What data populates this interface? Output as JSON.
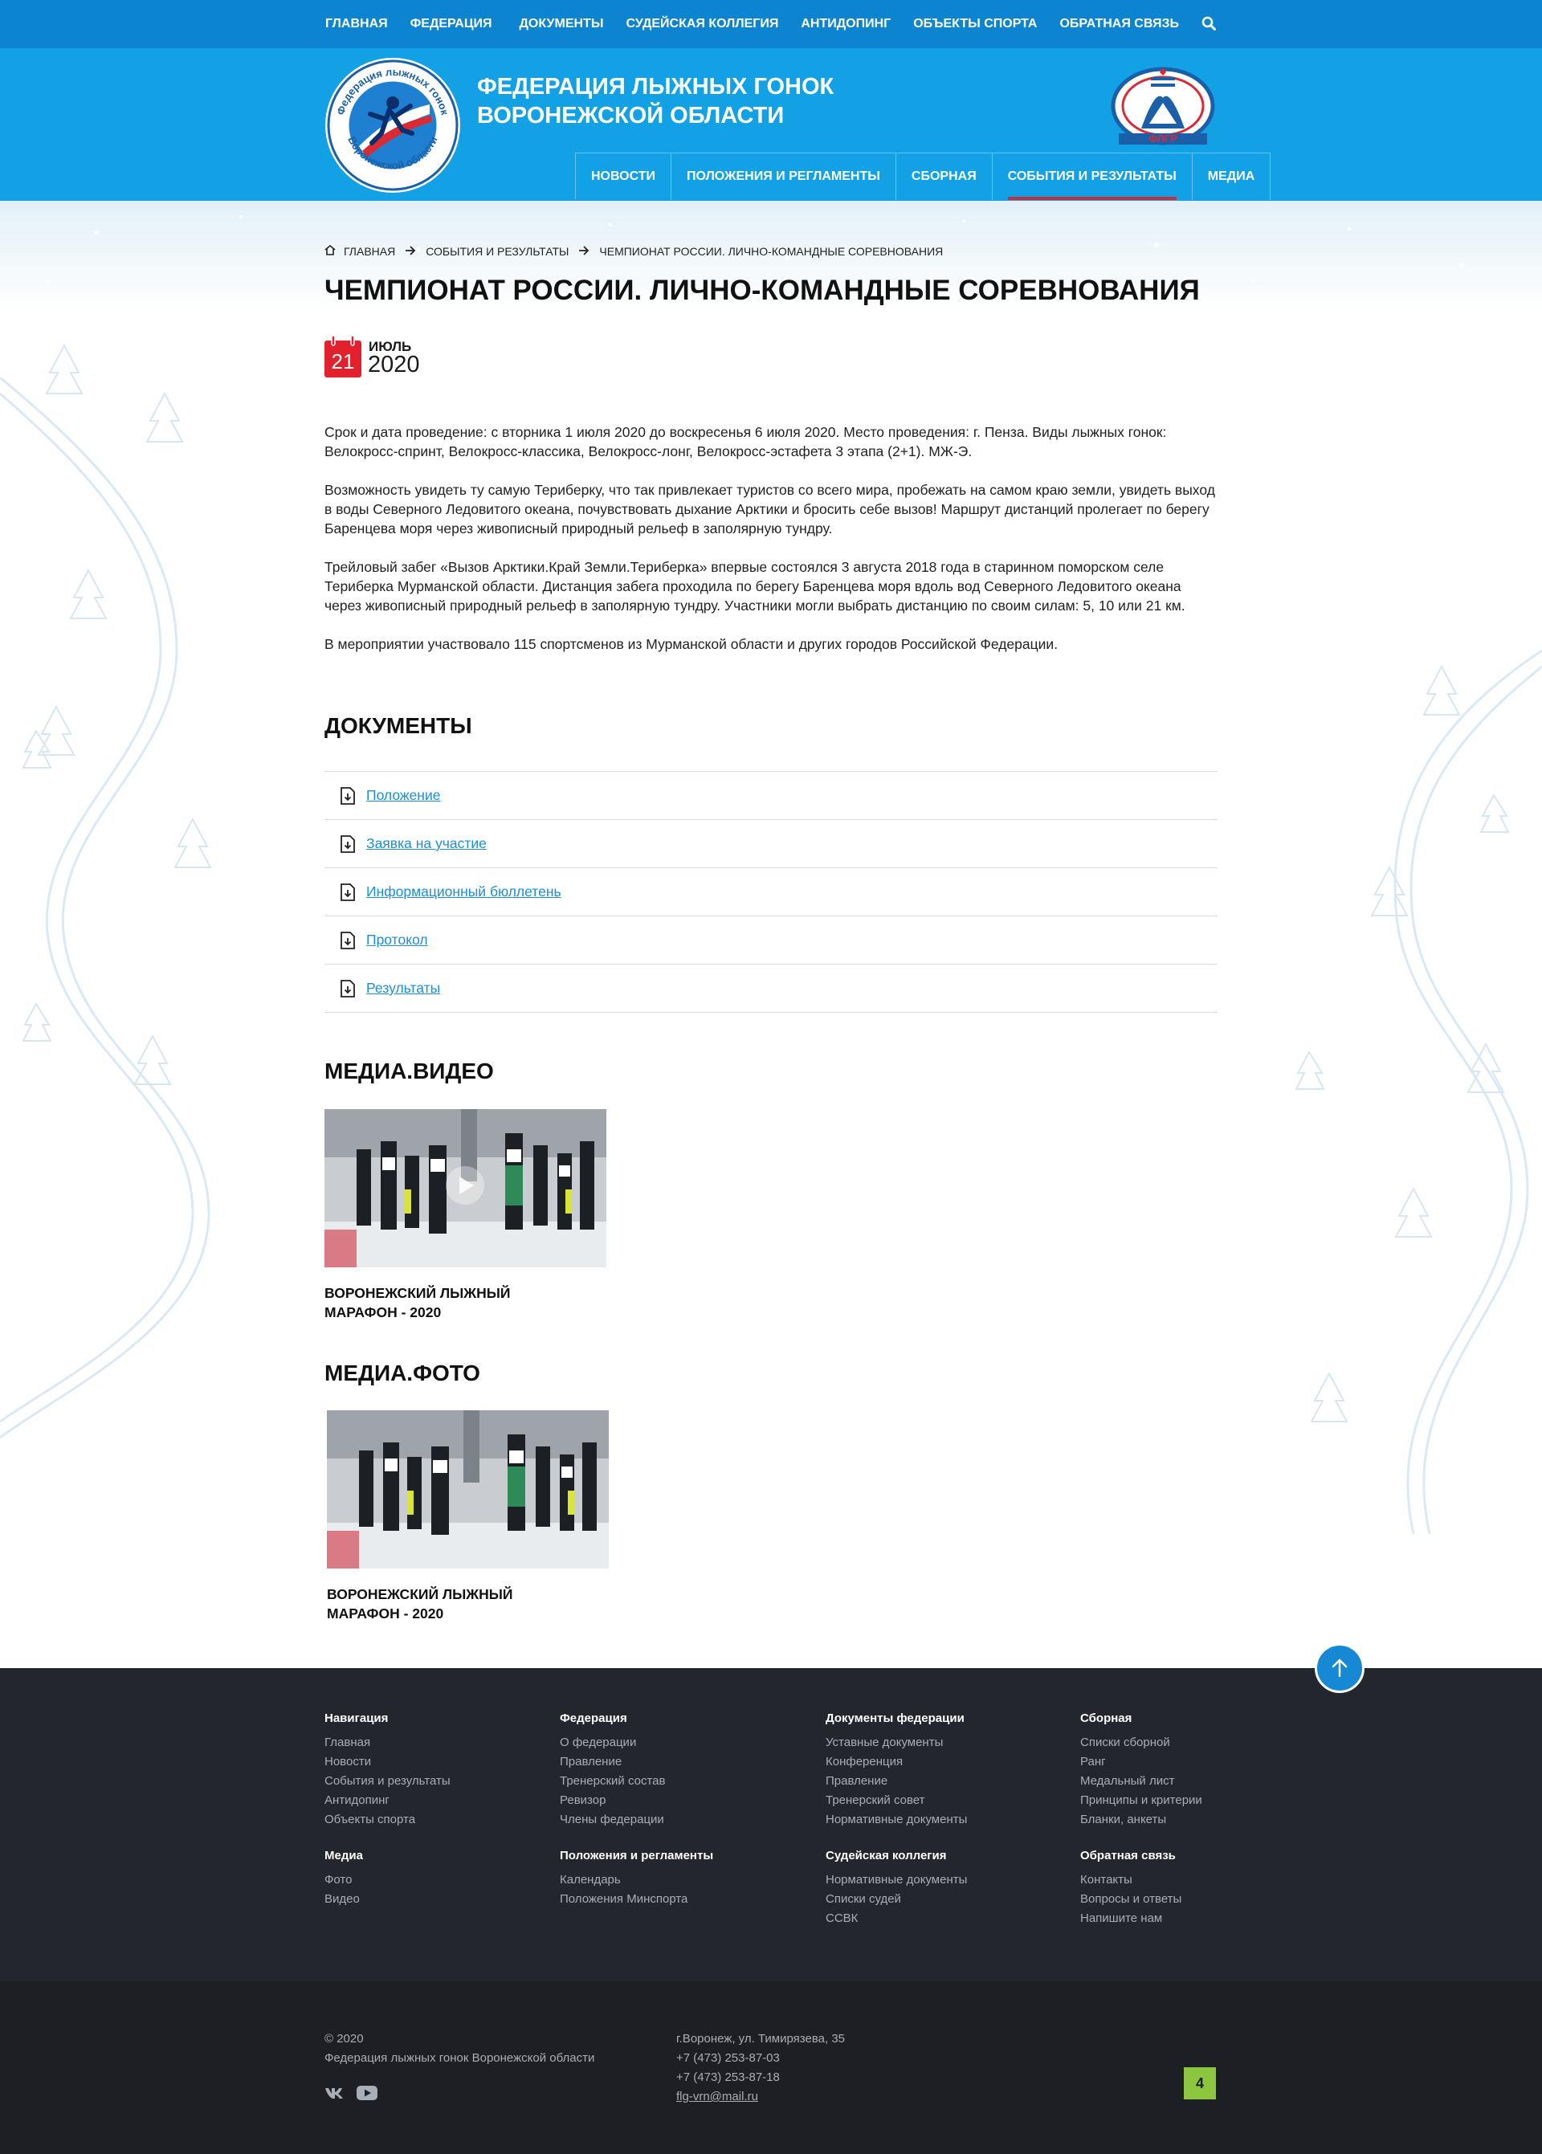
{
  "topnav": {
    "items": [
      "ГЛАВНАЯ",
      "ФЕДЕРАЦИЯ",
      "ДОКУМЕНТЫ",
      "СУДЕЙСКАЯ КОЛЛЕГИЯ",
      "АНТИДОПИНГ",
      "ОБЪЕКТЫ СПОРТА",
      "ОБРАТНАЯ СВЯЗЬ"
    ],
    "search_icon": "search-icon"
  },
  "header": {
    "title_line1": "ФЕДЕРАЦИЯ ЛЫЖНЫХ ГОНОК",
    "title_line2": "ВОРОНЕЖСКОЙ ОБЛАСТИ",
    "logo_left_text": "Федерация лыжных гонок Воронежской области",
    "logo_right_text": "ФЛГР"
  },
  "mainnav": {
    "items": [
      "НОВОСТИ",
      "ПОЛОЖЕНИЯ И РЕГЛАМЕНТЫ",
      "СБОРНАЯ",
      "СОБЫТИЯ И РЕЗУЛЬТАТЫ",
      "МЕДИА"
    ],
    "active": "СОБЫТИЯ И РЕЗУЛЬТАТЫ"
  },
  "breadcrumb": {
    "home": "ГЛАВНАЯ",
    "section": "СОБЫТИЯ И РЕЗУЛЬТАТЫ",
    "current": "ЧЕМПИОНАТ РОССИИ. ЛИЧНО-КОМАНДНЫЕ СОРЕВНОВАНИЯ"
  },
  "page": {
    "title": "ЧЕМПИОНАТ РОССИИ. ЛИЧНО-КОМАНДНЫЕ СОРЕВНОВАНИЯ",
    "date": {
      "day": "21",
      "month": "ИЮЛЬ",
      "year": "2020"
    },
    "paragraphs": [
      "Срок и дата проведение: с вторника 1 июля 2020 до воскресенья 6 июля 2020. Место проведения: г. Пенза. Виды лыжных гонок: Велокросс-спринт, Велокросс-классика, Велокросс-лонг, Велокросс-эстафета 3 этапа (2+1). МЖ-Э.",
      "Возможность увидеть ту самую Териберку, что так привлекает туристов со всего мира, пробежать на самом краю земли, увидеть выход в воды Северного Ледовитого океана, почувствовать дыхание Арктики и бросить себе вызов! Маршрут дистанций пролегает по берегу Баренцева моря через живописный природный рельеф в заполярную тундру.",
      "Трейловый забег «Вызов Арктики.Край Земли.Териберка» впервые состоялся 3 августа 2018 года в старинном поморском селе Териберка Мурманской области. Дистанция забега проходила по берегу Баренцева моря вдоль вод Северного Ледовитого океана через живописный природный рельеф в заполярную тундру. Участники могли выбрать дистанцию по своим силам: 5, 10 или 21 км.",
      "В мероприятии участвовало 115 спортсменов из Мурманской области и других городов Российской Федерации."
    ]
  },
  "documents": {
    "title": "ДОКУМЕНТЫ",
    "items": [
      "Положение",
      "Заявка на участие",
      "Информационный бюллетень",
      "Протокол",
      "Результаты"
    ]
  },
  "media_video": {
    "title": "МЕДИА.ВИДЕО",
    "caption": "ВОРОНЕЖСКИЙ ЛЫЖНЫЙ МАРАФОН - 2020"
  },
  "media_photo": {
    "title": "МЕДИА.ФОТО",
    "caption": "ВОРОНЕЖСКИЙ ЛЫЖНЫЙ МАРАФОН - 2020"
  },
  "footer": {
    "columns": [
      {
        "title": "Навигация",
        "links": [
          "Главная",
          "Новости",
          "События и результаты",
          "Антидопинг",
          "Объекты спорта"
        ]
      },
      {
        "title": "Федерация",
        "links": [
          "О федерации",
          "Правление",
          "Тренерский состав",
          "Ревизор",
          "Члены федерации"
        ]
      },
      {
        "title": "Документы федерации",
        "links": [
          "Уставные документы",
          "Конференция",
          "Правление",
          "Тренерский совет",
          "Нормативные документы"
        ]
      },
      {
        "title": "Сборная",
        "links": [
          "Списки сборной",
          "Ранг",
          "Медальный лист",
          "Принципы и критерии",
          "Бланки, анкеты"
        ]
      },
      {
        "title": "Медиа",
        "links": [
          "Фото",
          "Видео"
        ]
      },
      {
        "title": "Положения и регламенты",
        "links": [
          "Календарь",
          "Положения Минспорта"
        ]
      },
      {
        "title": "Судейская коллегия",
        "links": [
          "Нормативные документы",
          "Списки судей",
          "ССВК"
        ]
      },
      {
        "title": "Обратная связь",
        "links": [
          "Контакты",
          "Вопросы и ответы",
          "Напишите нам"
        ]
      }
    ]
  },
  "subfooter": {
    "copyright": "© 2020",
    "org": "Федерация лыжных гонок Воронежской области",
    "address": "г.Воронеж, ул. Тимирязева, 35",
    "phone1": "+7 (473) 253-87-03",
    "phone2": "+7 (473) 253-87-18",
    "email": "flg-vrn@mail.ru",
    "badge": "4",
    "social": [
      "vk-icon",
      "youtube-icon"
    ]
  },
  "colors": {
    "topbar": "#0d84cf",
    "header": "#13a1e6",
    "active_underline": "#c72f3c",
    "date_red": "#e3202d",
    "link_blue": "#1d8ed6",
    "footer_bg": "#24262d",
    "badge_green": "#8cc63f"
  }
}
